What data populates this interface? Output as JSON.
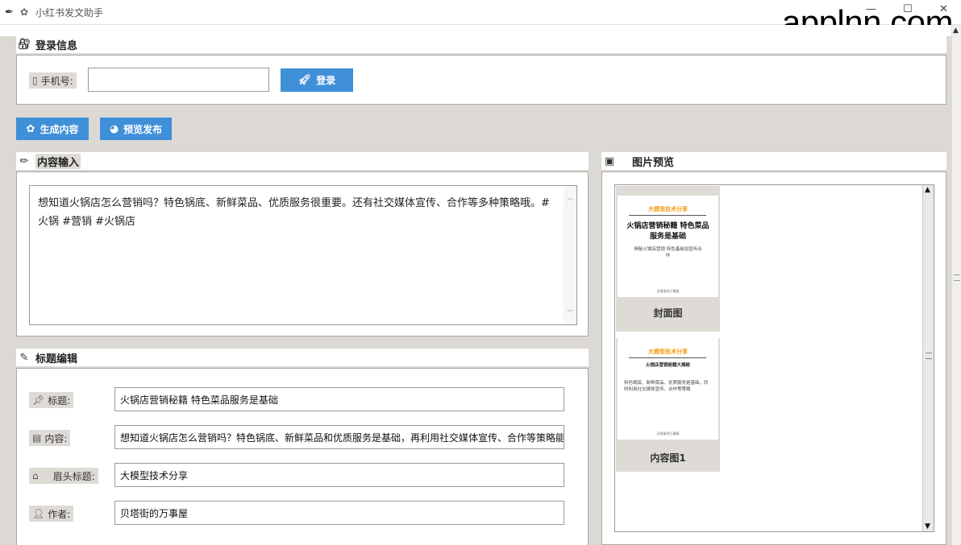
{
  "window": {
    "title": "小红书发文助手",
    "watermark": "applnn.com"
  },
  "login": {
    "section_title": "登录信息",
    "phone_label": "手机号:",
    "phone_value": "",
    "login_button": "登录"
  },
  "actions": {
    "generate_button": "生成内容",
    "preview_publish_button": "预览发布"
  },
  "content_input": {
    "section_title": "内容输入",
    "text": "想知道火锅店怎么营销吗？特色锅底、新鲜菜品、优质服务很重要。还有社交媒体宣传、合作等多种策略哦。#火锅 #营销 #火锅店"
  },
  "title_edit": {
    "section_title": "标题编辑",
    "fields": [
      {
        "label": "标题:",
        "icon": "pin-icon",
        "value": "火锅店营销秘籍 特色菜品服务是基础"
      },
      {
        "label": "内容:",
        "icon": "document-icon",
        "value": "想知道火锅店怎么营销吗？特色锅底、新鲜菜品和优质服务是基础，再利用社交媒体宣传、合作等策略能"
      },
      {
        "label": "眉头标题:",
        "icon": "tag-icon",
        "value": "大模型技术分享"
      },
      {
        "label": "作者:",
        "icon": "user-icon",
        "value": "贝塔街的万事屋"
      }
    ]
  },
  "image_preview": {
    "section_title": "图片预览",
    "items": [
      {
        "caption": "封面图",
        "header": "大模型技术分享",
        "headline": "火锅店营销秘籍 特色菜品服务是基础",
        "subtitle": "揭秘火锅店营销 特色基础加宣传合作",
        "footer": "贝塔街的万事屋"
      },
      {
        "caption": "内容图1",
        "header": "大模型技术分享",
        "headline": "火锅店营销秘籍大揭秘",
        "subtitle": "特色锅底、新鲜菜品、优质服务是基础，同时利用社交媒体宣传、合作等策略",
        "footer": "贝塔街的万事屋"
      }
    ]
  }
}
